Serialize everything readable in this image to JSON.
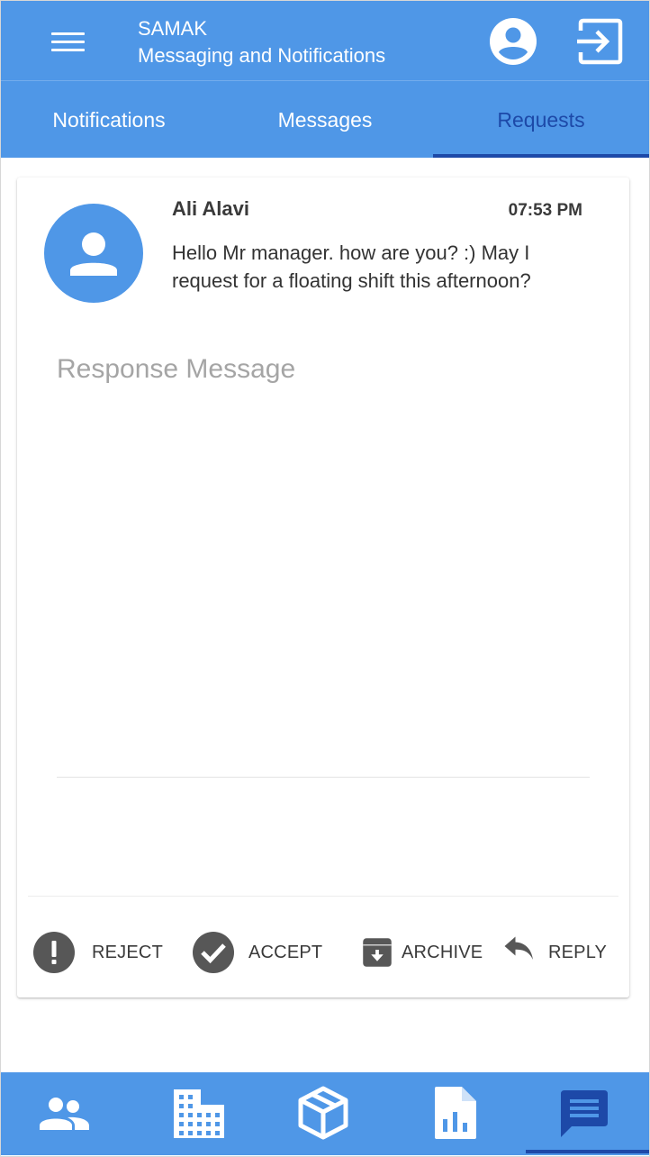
{
  "header": {
    "app_name": "SAMAK",
    "subtitle": "Messaging and Notifications",
    "menu_icon": "menu-icon",
    "profile_icon": "account-circle-icon",
    "logout_icon": "exit-icon"
  },
  "tabs": [
    {
      "label": "Notifications",
      "active": false
    },
    {
      "label": "Messages",
      "active": false
    },
    {
      "label": "Requests",
      "active": true
    }
  ],
  "request": {
    "sender": "Ali Alavi",
    "time": "07:53 PM",
    "message": "Hello Mr manager. how are you? :) May I request for a floating shift this afternoon?",
    "response_placeholder": "Response Message",
    "response_value": ""
  },
  "actions": [
    {
      "label": "REJECT",
      "icon": "alert-circle-icon"
    },
    {
      "label": "ACCEPT",
      "icon": "check-circle-icon"
    },
    {
      "label": "ARCHIVE",
      "icon": "archive-icon"
    },
    {
      "label": "REPLY",
      "icon": "reply-icon"
    }
  ],
  "bottom_nav": [
    {
      "icon": "people-icon",
      "active": false
    },
    {
      "icon": "building-icon",
      "active": false
    },
    {
      "icon": "package-icon",
      "active": false
    },
    {
      "icon": "report-icon",
      "active": false
    },
    {
      "icon": "message-icon",
      "active": true
    }
  ],
  "colors": {
    "primary": "#4f97e7",
    "accent_dark": "#1d49a8",
    "icon_dark": "#575757",
    "text_dark": "#3a3a3a",
    "placeholder": "#a5a5a5"
  }
}
